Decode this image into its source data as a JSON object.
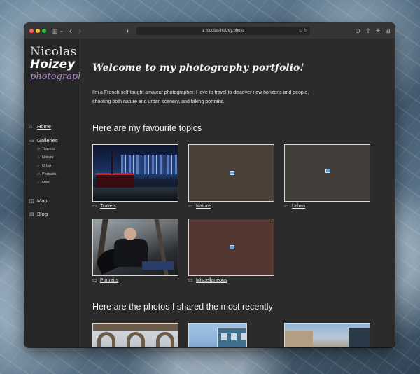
{
  "browser": {
    "url": "nicolas-hoizey.photo",
    "buttons": {
      "sidebar_toggle": "▥",
      "chevron": "⌄",
      "back": "‹",
      "forward": "›",
      "shield": "◐",
      "downloads": "⊙",
      "share": "⇧",
      "new_tab": "+",
      "tab_overview": "⊞"
    }
  },
  "sidebar": {
    "logo": {
      "first": "Nicolas",
      "last": "Hoizey",
      "sub": "photography"
    },
    "nav": [
      {
        "label": "Home",
        "icon": "⌂",
        "active": true
      },
      {
        "label": "Galleries",
        "icon": "▭"
      },
      {
        "label": "Map",
        "icon": "◫"
      },
      {
        "label": "Blog",
        "icon": "▤"
      }
    ],
    "galleries": [
      {
        "label": "Travels",
        "icon": "⊙"
      },
      {
        "label": "Nature",
        "icon": "♧"
      },
      {
        "label": "Urban",
        "icon": "⌂"
      },
      {
        "label": "Portraits",
        "icon": "▭"
      },
      {
        "label": "Misc.",
        "icon": "○"
      }
    ]
  },
  "main": {
    "welcome": "Welcome to my photography portfolio!",
    "intro": {
      "t1": "I'm a French self-taught amateur photographer. I love to ",
      "link_travel": "travel",
      "t2": " to discover new horizons and people, shooting both ",
      "link_nature": "nature",
      "t3": " and ",
      "link_urban": "urban",
      "t4": " scenery, and taking ",
      "link_portraits": "portraits",
      "t5": "."
    },
    "topics_heading": "Here are my favourite topics",
    "topics": [
      {
        "label": "Travels",
        "icon": "folder-icon",
        "color": "#0e1a33"
      },
      {
        "label": "Nature",
        "icon": "folder-icon",
        "color": "#4a4038"
      },
      {
        "label": "Urban",
        "icon": "folder-icon",
        "color": "#423f3a"
      },
      {
        "label": "Portraits",
        "icon": "folder-icon",
        "color": "#3a3d41"
      },
      {
        "label": "Miscellaneous",
        "icon": "folder-icon",
        "color": "#553731"
      }
    ],
    "recent_heading": "Here are the photos I shared the most recently"
  }
}
